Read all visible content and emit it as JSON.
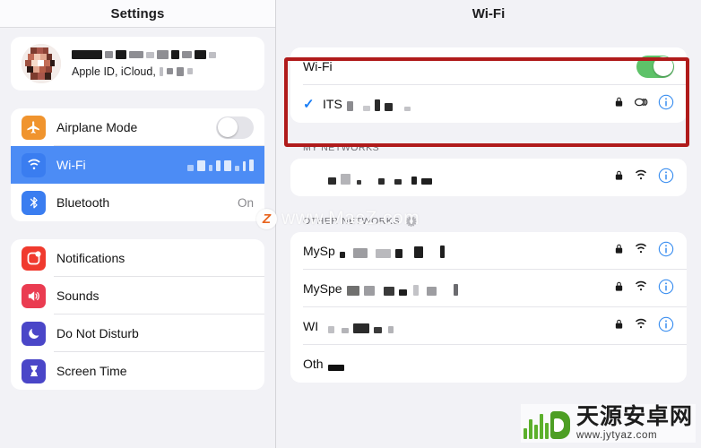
{
  "sidebar": {
    "title": "Settings",
    "profile": {
      "subtitle": "Apple ID, iCloud,",
      "name_redacted": true
    },
    "groups": [
      {
        "items": [
          {
            "label": "Airplane Mode",
            "icon": "airplane-icon",
            "icon_color": "#f0942e",
            "control": "toggle",
            "toggle_on": false,
            "value": ""
          },
          {
            "label": "Wi-Fi",
            "icon": "wifi-icon",
            "icon_color": "#3a7df0",
            "control": "redacted",
            "selected": true,
            "value": ""
          },
          {
            "label": "Bluetooth",
            "icon": "bluetooth-icon",
            "icon_color": "#3a7df0",
            "control": "value",
            "value": "On"
          }
        ]
      },
      {
        "items": [
          {
            "label": "Notifications",
            "icon": "notification-icon",
            "icon_color": "#f03a2e",
            "control": "none",
            "value": ""
          },
          {
            "label": "Sounds",
            "icon": "speaker-icon",
            "icon_color": "#ea3c51",
            "control": "none",
            "value": ""
          },
          {
            "label": "Do Not Disturb",
            "icon": "moon-icon",
            "icon_color": "#4a46c8",
            "control": "none",
            "value": ""
          },
          {
            "label": "Screen Time",
            "icon": "hourglass-icon",
            "icon_color": "#4a46c8",
            "control": "none",
            "value": ""
          }
        ]
      }
    ]
  },
  "main": {
    "title": "Wi-Fi",
    "wifi_toggle": {
      "label": "Wi-Fi",
      "on": true,
      "on_color": "#5ec269"
    },
    "connected_network": {
      "name_prefix": "ITS",
      "name_redacted": true,
      "checked": true,
      "icons": [
        "lock-icon",
        "link-icon",
        "info-icon"
      ]
    },
    "my_networks": {
      "header": "MY NETWORKS",
      "rows": [
        {
          "name_prefix": "",
          "name_redacted": true,
          "icons": [
            "lock-icon",
            "wifi-signal-icon",
            "info-icon"
          ]
        }
      ]
    },
    "other_networks": {
      "header": "OTHER NETWORKS",
      "loading": true,
      "rows": [
        {
          "name_prefix": "MySp",
          "name_redacted": true,
          "icons": [
            "lock-icon",
            "wifi-signal-icon",
            "info-icon"
          ]
        },
        {
          "name_prefix": "MySpe",
          "name_redacted": true,
          "icons": [
            "lock-icon",
            "wifi-signal-icon",
            "info-icon"
          ]
        },
        {
          "name_prefix": "WI",
          "name_redacted": true,
          "icons": [
            "lock-icon",
            "wifi-signal-icon",
            "info-icon"
          ]
        },
        {
          "name_prefix": "Oth",
          "name_redacted": true,
          "icons": []
        }
      ]
    },
    "highlight_box": {
      "color": "#b01b1b"
    }
  },
  "watermarks": {
    "center": {
      "text": "www.MacZ.com",
      "badge": "Z",
      "badge_color": "#e8641e"
    },
    "bottom_right": {
      "cn_text": "天源安卓网",
      "url": "www.jytyaz.com",
      "brand_color": "#4d9f24"
    }
  }
}
